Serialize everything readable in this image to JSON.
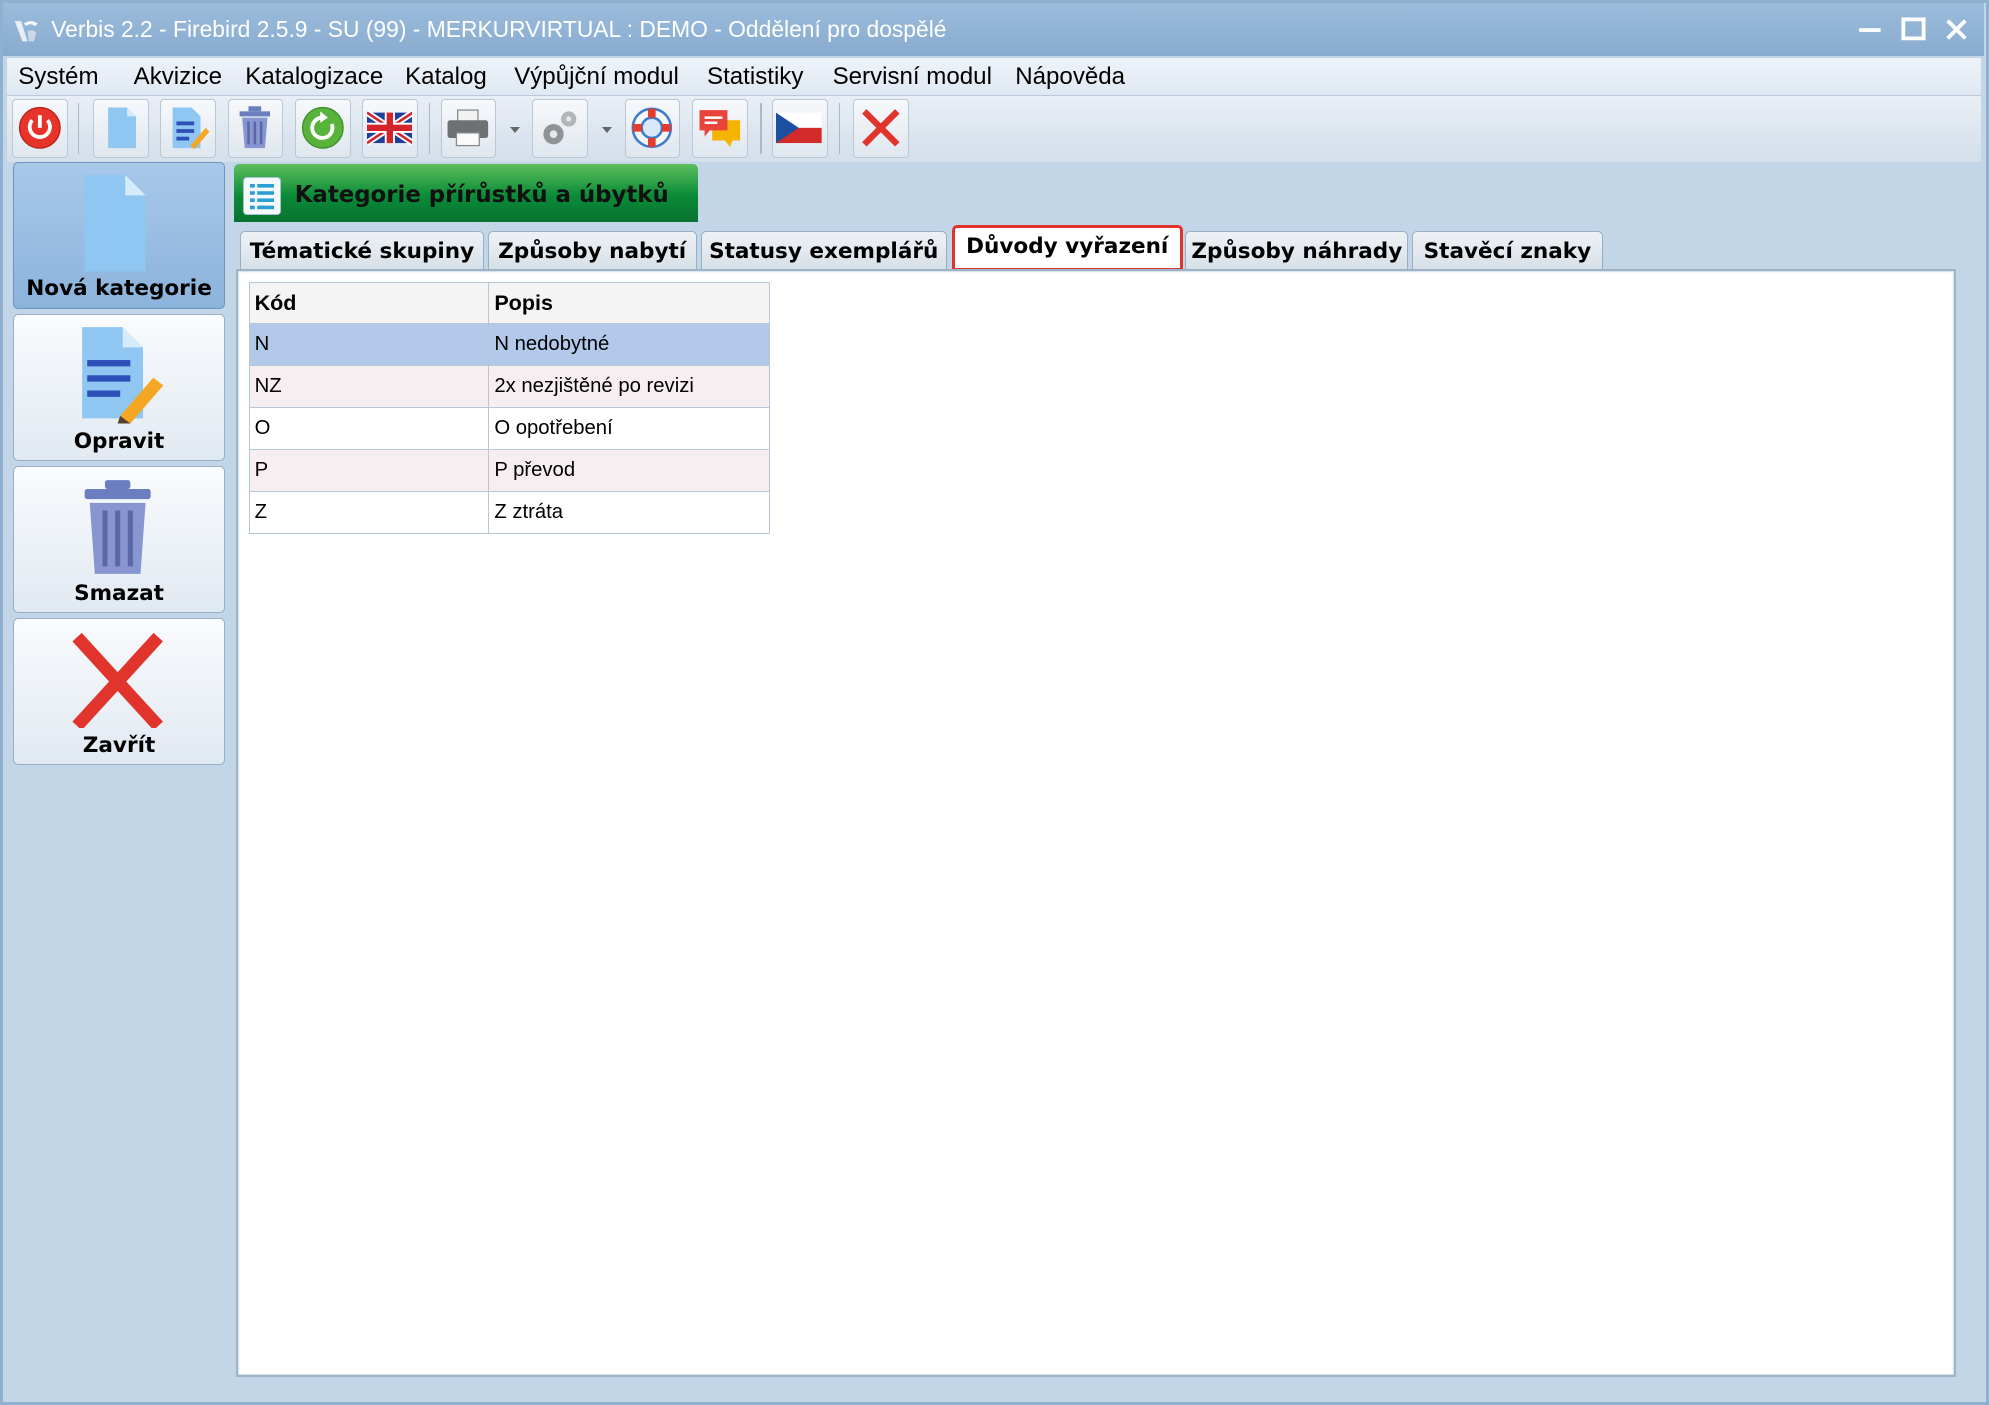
{
  "window": {
    "title": "Verbis 2.2 - Firebird 2.5.9 - SU (99) - MERKURVIRTUAL : DEMO - Oddělení pro dospělé"
  },
  "menu": [
    "Systém",
    "Akvizice",
    "Katalogizace",
    "Katalog",
    "Výpůjční modul",
    "Statistiky",
    "Servisní modul",
    "Nápověda"
  ],
  "toolbar": {
    "icons": [
      "power-icon",
      "new-document-icon",
      "edit-document-icon",
      "trash-icon",
      "refresh-icon",
      "uk-flag-icon",
      "printer-icon",
      "gears-icon",
      "lifebuoy-icon",
      "chat-icon",
      "czech-flag-icon",
      "close-icon"
    ]
  },
  "sidebar": {
    "new_label": "Nová kategorie",
    "edit_label": "Opravit",
    "delete_label": "Smazat",
    "close_label": "Zavřít"
  },
  "panel": {
    "title": "Kategorie přírůstků a úbytků"
  },
  "tabs": [
    "Tématické skupiny",
    "Způsoby nabytí",
    "Statusy exemplářů",
    "Důvody vyřazení",
    "Způsoby náhrady",
    "Stavěcí znaky"
  ],
  "active_tab": "Důvody vyřazení",
  "grid": {
    "headers": [
      "Kód",
      "Popis"
    ],
    "rows": [
      [
        "N",
        "N nedobytné"
      ],
      [
        "NZ",
        "2x nezjištěné po revizi"
      ],
      [
        "O",
        "O opotřebení"
      ],
      [
        "P",
        "P převod"
      ],
      [
        "Z",
        "Z ztráta"
      ]
    ],
    "selected_row": 0
  }
}
